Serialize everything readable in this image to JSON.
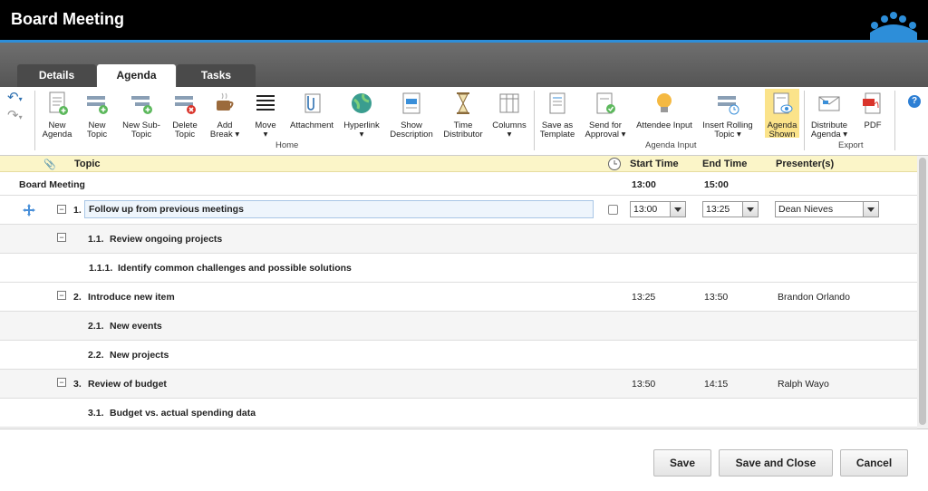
{
  "window": {
    "title": "Board Meeting"
  },
  "tabs": [
    {
      "label": "Details"
    },
    {
      "label": "Agenda"
    },
    {
      "label": "Tasks"
    }
  ],
  "ribbon": {
    "new_agenda": "New Agenda",
    "new_topic": "New Topic",
    "new_subtopic": "New Sub-Topic",
    "delete_topic": "Delete Topic",
    "add_break": "Add Break",
    "move": "Move",
    "attachment": "Attachment",
    "hyperlink": "Hyperlink",
    "show_description": "Show Description",
    "time_distributor": "Time Distributor",
    "columns": "Columns",
    "save_as_template": "Save as Template",
    "send_for_approval": "Send for Approval",
    "attendee_input": "Attendee Input",
    "insert_rolling_topic": "Insert Rolling Topic",
    "agenda_shown": "Agenda Shown",
    "distribute_agenda": "Distribute Agenda",
    "pdf": "PDF",
    "group_home": "Home",
    "group_agenda_input": "Agenda Input",
    "group_export": "Export",
    "help": "?"
  },
  "columns": {
    "topic": "Topic",
    "start_time": "Start Time",
    "end_time": "End Time",
    "presenters": "Presenter(s)"
  },
  "meeting": {
    "name": "Board Meeting",
    "start": "13:00",
    "end": "15:00"
  },
  "rows": [
    {
      "num": "1.",
      "title": "Follow up from previous meetings",
      "start": "13:00",
      "end": "13:25",
      "presenter": "Dean Nieves"
    },
    {
      "num": "1.1.",
      "title": "Review ongoing projects"
    },
    {
      "num": "1.1.1.",
      "title": "Identify common challenges and possible solutions"
    },
    {
      "num": "2.",
      "title": "Introduce new item",
      "start": "13:25",
      "end": "13:50",
      "presenter": "Brandon Orlando"
    },
    {
      "num": "2.1.",
      "title": "New events"
    },
    {
      "num": "2.2.",
      "title": "New projects"
    },
    {
      "num": "3.",
      "title": "Review of budget",
      "start": "13:50",
      "end": "14:15",
      "presenter": "Ralph Wayo"
    },
    {
      "num": "3.1.",
      "title": "Budget vs. actual spending data"
    }
  ],
  "footer": {
    "save": "Save",
    "save_close": "Save and Close",
    "cancel": "Cancel"
  },
  "colors": {
    "accent": "#2d8ed9",
    "header_bg": "#fbf5c8",
    "titlebar": "#000000"
  }
}
